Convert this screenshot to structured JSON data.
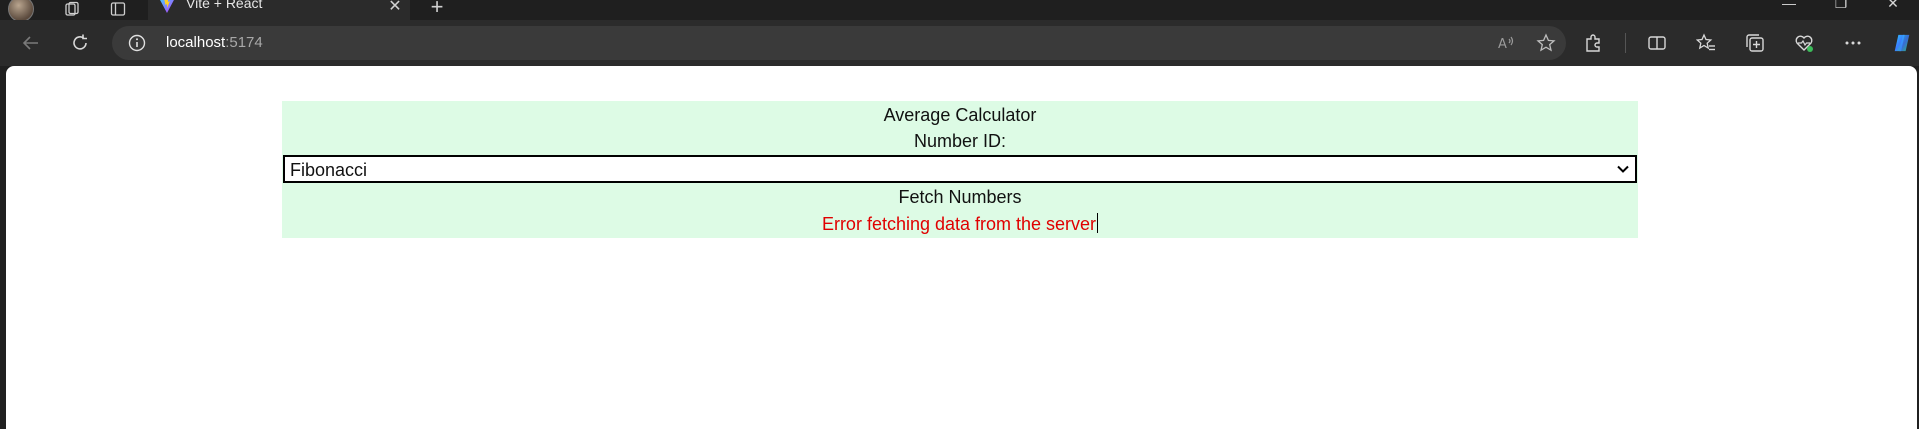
{
  "browser": {
    "tab": {
      "title": "Vite + React"
    },
    "address": {
      "host": "localhost",
      "port": ":5174"
    },
    "colors": {
      "frame": "#1f1f1f",
      "toolbar": "#2b2b2b",
      "addressbar": "#3a3a3a"
    }
  },
  "app": {
    "title": "Average Calculator",
    "number_id_label": "Number ID:",
    "select": {
      "value": "Fibonacci"
    },
    "fetch_label": "Fetch Numbers",
    "error": "Error fetching data from the server",
    "colors": {
      "card_bg": "#ddfbe5",
      "error": "#e00000"
    }
  }
}
